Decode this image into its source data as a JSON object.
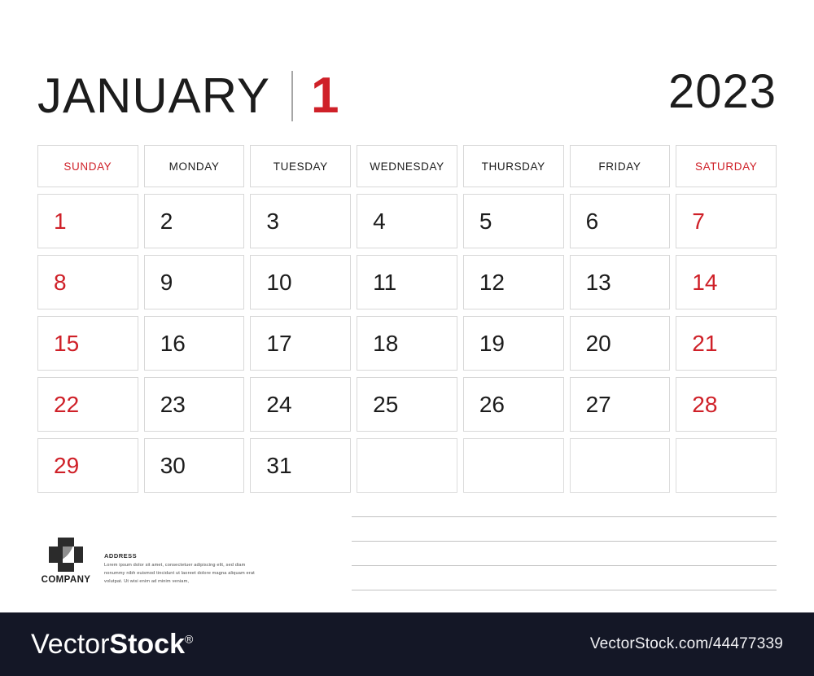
{
  "header": {
    "month_name": "JANUARY",
    "month_number": "1",
    "year": "2023",
    "accent_color": "#cf2028",
    "text_color": "#1c1c1c"
  },
  "calendar": {
    "weekday_headers": [
      {
        "label": "SUNDAY",
        "weekend": true
      },
      {
        "label": "MONDAY",
        "weekend": false
      },
      {
        "label": "TUESDAY",
        "weekend": false
      },
      {
        "label": "WEDNESDAY",
        "weekend": false
      },
      {
        "label": "THURSDAY",
        "weekend": false
      },
      {
        "label": "FRIDAY",
        "weekend": false
      },
      {
        "label": "SATURDAY",
        "weekend": true
      }
    ],
    "weeks": [
      [
        {
          "day": "1",
          "weekend": true
        },
        {
          "day": "2",
          "weekend": false
        },
        {
          "day": "3",
          "weekend": false
        },
        {
          "day": "4",
          "weekend": false
        },
        {
          "day": "5",
          "weekend": false
        },
        {
          "day": "6",
          "weekend": false
        },
        {
          "day": "7",
          "weekend": true
        }
      ],
      [
        {
          "day": "8",
          "weekend": true
        },
        {
          "day": "9",
          "weekend": false
        },
        {
          "day": "10",
          "weekend": false
        },
        {
          "day": "11",
          "weekend": false
        },
        {
          "day": "12",
          "weekend": false
        },
        {
          "day": "13",
          "weekend": false
        },
        {
          "day": "14",
          "weekend": true
        }
      ],
      [
        {
          "day": "15",
          "weekend": true
        },
        {
          "day": "16",
          "weekend": false
        },
        {
          "day": "17",
          "weekend": false
        },
        {
          "day": "18",
          "weekend": false
        },
        {
          "day": "19",
          "weekend": false
        },
        {
          "day": "20",
          "weekend": false
        },
        {
          "day": "21",
          "weekend": true
        }
      ],
      [
        {
          "day": "22",
          "weekend": true
        },
        {
          "day": "23",
          "weekend": false
        },
        {
          "day": "24",
          "weekend": false
        },
        {
          "day": "25",
          "weekend": false
        },
        {
          "day": "26",
          "weekend": false
        },
        {
          "day": "27",
          "weekend": false
        },
        {
          "day": "28",
          "weekend": true
        }
      ],
      [
        {
          "day": "29",
          "weekend": true
        },
        {
          "day": "30",
          "weekend": false
        },
        {
          "day": "31",
          "weekend": false
        },
        {
          "day": "",
          "weekend": false
        },
        {
          "day": "",
          "weekend": false
        },
        {
          "day": "",
          "weekend": false
        },
        {
          "day": "",
          "weekend": true
        }
      ]
    ]
  },
  "footer": {
    "company_name": "COMPANY",
    "logo_icon": "square-cross-arc-logo-icon",
    "address_title": "ADDRESS",
    "address_text": "Lorem ipsum dolor sit amet, consectetuer adipiscing elit, sed diam nonummy nibh euismod tincidunt ut laoreet dolore magna aliquam erat volutpat. Ut wisi enim ad minim veniam,",
    "note_line_count": 4
  },
  "watermark": {
    "brand_light": "Vector",
    "brand_bold": "Stock",
    "registered_mark": "®",
    "url": "VectorStock.com/44477339",
    "background_color": "#141726"
  }
}
